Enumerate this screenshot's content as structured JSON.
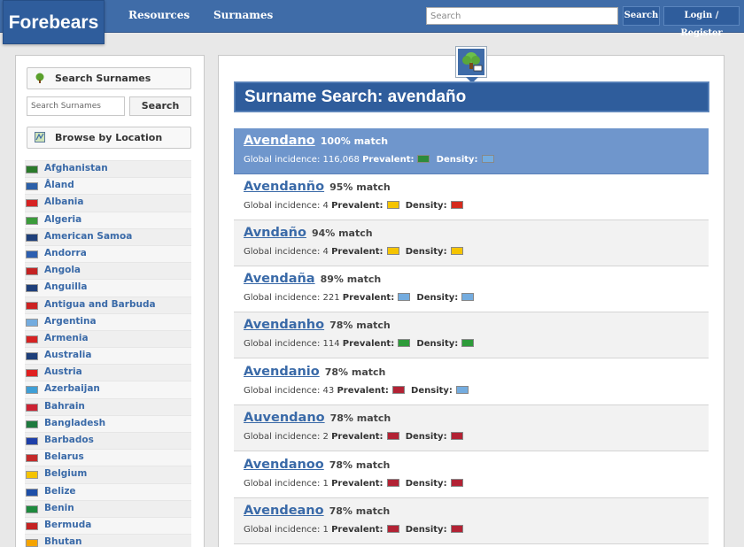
{
  "header": {
    "logo": "Forebears",
    "nav": [
      "Resources",
      "Surnames"
    ],
    "search_placeholder": "Search",
    "search_button": "Search",
    "login_button": "Login / Register"
  },
  "sidebar": {
    "search_surnames_label": "Search Surnames",
    "search_input_placeholder": "Search Surnames",
    "search_button": "Search",
    "browse_location_label": "Browse by Location",
    "countries": [
      {
        "name": "Afghanistan",
        "flag": "#2a7a2a"
      },
      {
        "name": "Åland",
        "flag": "#2b5fa8"
      },
      {
        "name": "Albania",
        "flag": "#d62222"
      },
      {
        "name": "Algeria",
        "flag": "#3b9b3b"
      },
      {
        "name": "American Samoa",
        "flag": "#1e3f7a"
      },
      {
        "name": "Andorra",
        "flag": "#2d5fb0"
      },
      {
        "name": "Angola",
        "flag": "#c42222"
      },
      {
        "name": "Anguilla",
        "flag": "#1e3f7a"
      },
      {
        "name": "Antigua and Barbuda",
        "flag": "#cc2222"
      },
      {
        "name": "Argentina",
        "flag": "#74acdf"
      },
      {
        "name": "Armenia",
        "flag": "#d62222"
      },
      {
        "name": "Australia",
        "flag": "#1e3f7a"
      },
      {
        "name": "Austria",
        "flag": "#e02020"
      },
      {
        "name": "Azerbaijan",
        "flag": "#3f9fd6"
      },
      {
        "name": "Bahrain",
        "flag": "#cc2233"
      },
      {
        "name": "Bangladesh",
        "flag": "#1e7a3e"
      },
      {
        "name": "Barbados",
        "flag": "#1e3fa8"
      },
      {
        "name": "Belarus",
        "flag": "#c42a2a"
      },
      {
        "name": "Belgium",
        "flag": "#f5c400"
      },
      {
        "name": "Belize",
        "flag": "#1e4fa8"
      },
      {
        "name": "Benin",
        "flag": "#1e8a3e"
      },
      {
        "name": "Bermuda",
        "flag": "#c42222"
      },
      {
        "name": "Bhutan",
        "flag": "#f5a400"
      }
    ]
  },
  "main": {
    "title": "Surname Search: avendaño",
    "labels": {
      "incidence": "Global incidence:",
      "prevalent": "Prevalent:",
      "density": "Density:"
    },
    "results": [
      {
        "name": "Avendano",
        "match": "100% match",
        "incidence": "116,068",
        "prevalent_flag": "#2e8b3a",
        "density_flag": "#74acdf"
      },
      {
        "name": "Avendanño",
        "match": "95% match",
        "incidence": "4",
        "prevalent_flag": "#f5c400",
        "density_flag": "#d52b1e"
      },
      {
        "name": "Avndaño",
        "match": "94% match",
        "incidence": "4",
        "prevalent_flag": "#f5c400",
        "density_flag": "#f5c400"
      },
      {
        "name": "Avendaña",
        "match": "89% match",
        "incidence": "221",
        "prevalent_flag": "#74acdf",
        "density_flag": "#74acdf"
      },
      {
        "name": "Avendanho",
        "match": "78% match",
        "incidence": "114",
        "prevalent_flag": "#2e9b3a",
        "density_flag": "#2e9b3a"
      },
      {
        "name": "Avendanio",
        "match": "78% match",
        "incidence": "43",
        "prevalent_flag": "#b22234",
        "density_flag": "#74acdf"
      },
      {
        "name": "Auvendano",
        "match": "78% match",
        "incidence": "2",
        "prevalent_flag": "#b22234",
        "density_flag": "#b22234"
      },
      {
        "name": "Avendanoo",
        "match": "78% match",
        "incidence": "1",
        "prevalent_flag": "#b22234",
        "density_flag": "#b22234"
      },
      {
        "name": "Avendeano",
        "match": "78% match",
        "incidence": "1",
        "prevalent_flag": "#b22234",
        "density_flag": "#b22234"
      }
    ]
  }
}
